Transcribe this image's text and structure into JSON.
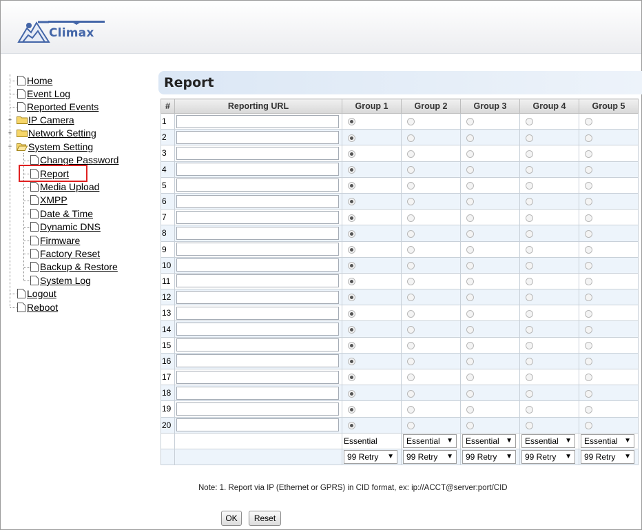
{
  "brand": {
    "name": "Climax"
  },
  "nav": {
    "items": [
      {
        "label": "Home"
      },
      {
        "label": "Event Log"
      },
      {
        "label": "Reported Events"
      },
      {
        "label": "IP Camera"
      },
      {
        "label": "Network Setting"
      },
      {
        "label": "System Setting"
      },
      {
        "label": "Change Password"
      },
      {
        "label": "Report"
      },
      {
        "label": "Media Upload"
      },
      {
        "label": "XMPP"
      },
      {
        "label": "Date & Time"
      },
      {
        "label": "Dynamic DNS"
      },
      {
        "label": "Firmware"
      },
      {
        "label": "Factory Reset"
      },
      {
        "label": "Backup & Restore"
      },
      {
        "label": "System Log"
      },
      {
        "label": "Logout"
      },
      {
        "label": "Reboot"
      }
    ],
    "selected": "Report"
  },
  "page": {
    "title": "Report"
  },
  "table": {
    "headers": [
      "#",
      "Reporting URL",
      "Group 1",
      "Group 2",
      "Group 3",
      "Group 4",
      "Group 5"
    ],
    "rows": [
      "1",
      "2",
      "3",
      "4",
      "5",
      "6",
      "7",
      "8",
      "9",
      "10",
      "11",
      "12",
      "13",
      "14",
      "15",
      "16",
      "17",
      "18",
      "19",
      "20"
    ],
    "selected_group": "Group 1",
    "report_type": [
      "Essential",
      "Essential",
      "Essential",
      "Essential",
      "Essential"
    ],
    "retry": [
      "99 Retry",
      "99 Retry",
      "99 Retry",
      "99 Retry",
      "99 Retry"
    ]
  },
  "note": "Note:  1. Report via IP (Ethernet or GPRS) in CID format, ex: ip://ACCT@server:port/CID",
  "buttons": {
    "ok": "OK",
    "reset": "Reset"
  },
  "colors": {
    "accent": "#4466a8",
    "selection_outline": "#e02020",
    "title_bar": "#dbe7f5"
  }
}
